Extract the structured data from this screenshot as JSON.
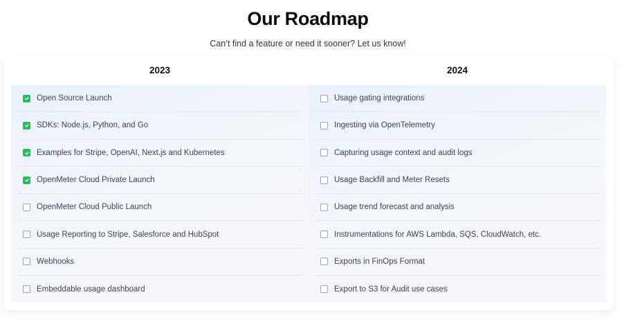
{
  "header": {
    "title": "Our Roadmap",
    "subtitle": "Can’t find a feature or need it sooner? Let us know!"
  },
  "columns": [
    {
      "year": "2023",
      "items": [
        {
          "label": "Open Source Launch",
          "checked": true
        },
        {
          "label": "SDKs: Node.js, Python, and Go",
          "checked": true
        },
        {
          "label": "Examples for Stripe, OpenAI, Next.js and Kubernetes",
          "checked": true
        },
        {
          "label": "OpenMeter Cloud Private Launch",
          "checked": true
        },
        {
          "label": "OpenMeter Cloud Public Launch",
          "checked": false
        },
        {
          "label": "Usage Reporting to Stripe, Salesforce and HubSpot",
          "checked": false
        },
        {
          "label": "Webhooks",
          "checked": false
        },
        {
          "label": "Embeddable usage dashboard",
          "checked": false
        }
      ]
    },
    {
      "year": "2024",
      "items": [
        {
          "label": "Usage gating integrations",
          "checked": false
        },
        {
          "label": "Ingesting via OpenTelemetry",
          "checked": false
        },
        {
          "label": "Capturing usage context and audit logs",
          "checked": false
        },
        {
          "label": "Usage Backfill and Meter Resets",
          "checked": false
        },
        {
          "label": "Usage trend forecast and analysis",
          "checked": false
        },
        {
          "label": "Instrumentations for AWS Lambda, SQS, CloudWatch, etc.",
          "checked": false
        },
        {
          "label": "Exports in FinOps Format",
          "checked": false
        },
        {
          "label": "Export to S3 for Audit use cases",
          "checked": false
        }
      ]
    }
  ],
  "colors": {
    "checked": "#22c05a"
  }
}
